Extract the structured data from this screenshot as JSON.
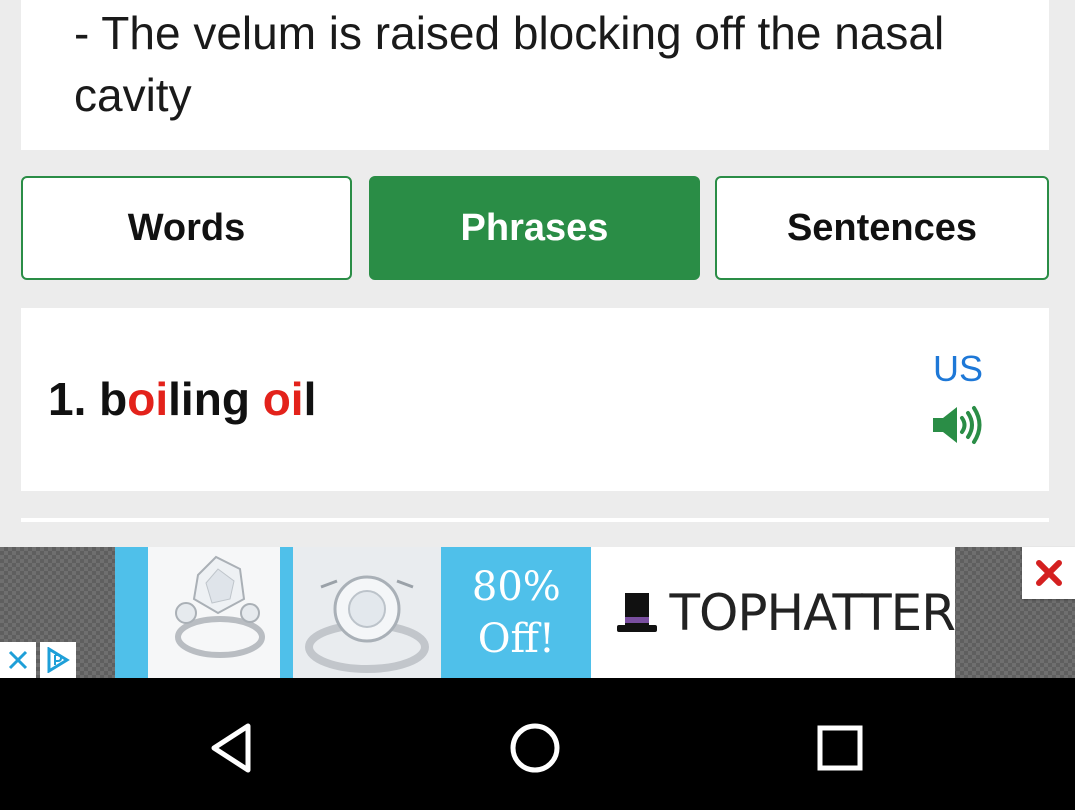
{
  "description": {
    "text": "- The velum is raised blocking off the nasal cavity"
  },
  "tabs": [
    {
      "label": "Words",
      "active": false
    },
    {
      "label": "Phrases",
      "active": true
    },
    {
      "label": "Sentences",
      "active": false
    }
  ],
  "phrase": {
    "number": "1.",
    "parts": [
      "b",
      "oi",
      "ling ",
      "oi",
      "l"
    ],
    "highlight_color": "#e3221b",
    "accent_label": "US",
    "speaker_icon": "speaker-volume-icon"
  },
  "ad": {
    "offer_line1": "80%",
    "offer_line2": "Off!",
    "brand": "TOPHATTER",
    "close_icon": "close-icon",
    "adchoices_icons": [
      "close-icon",
      "adchoices-icon"
    ]
  },
  "navbar": {
    "icons": [
      "back-icon",
      "home-icon",
      "recents-icon"
    ]
  },
  "colors": {
    "accent_green": "#2a8d46",
    "link_blue": "#1e78d7",
    "highlight_red": "#e3221b"
  }
}
